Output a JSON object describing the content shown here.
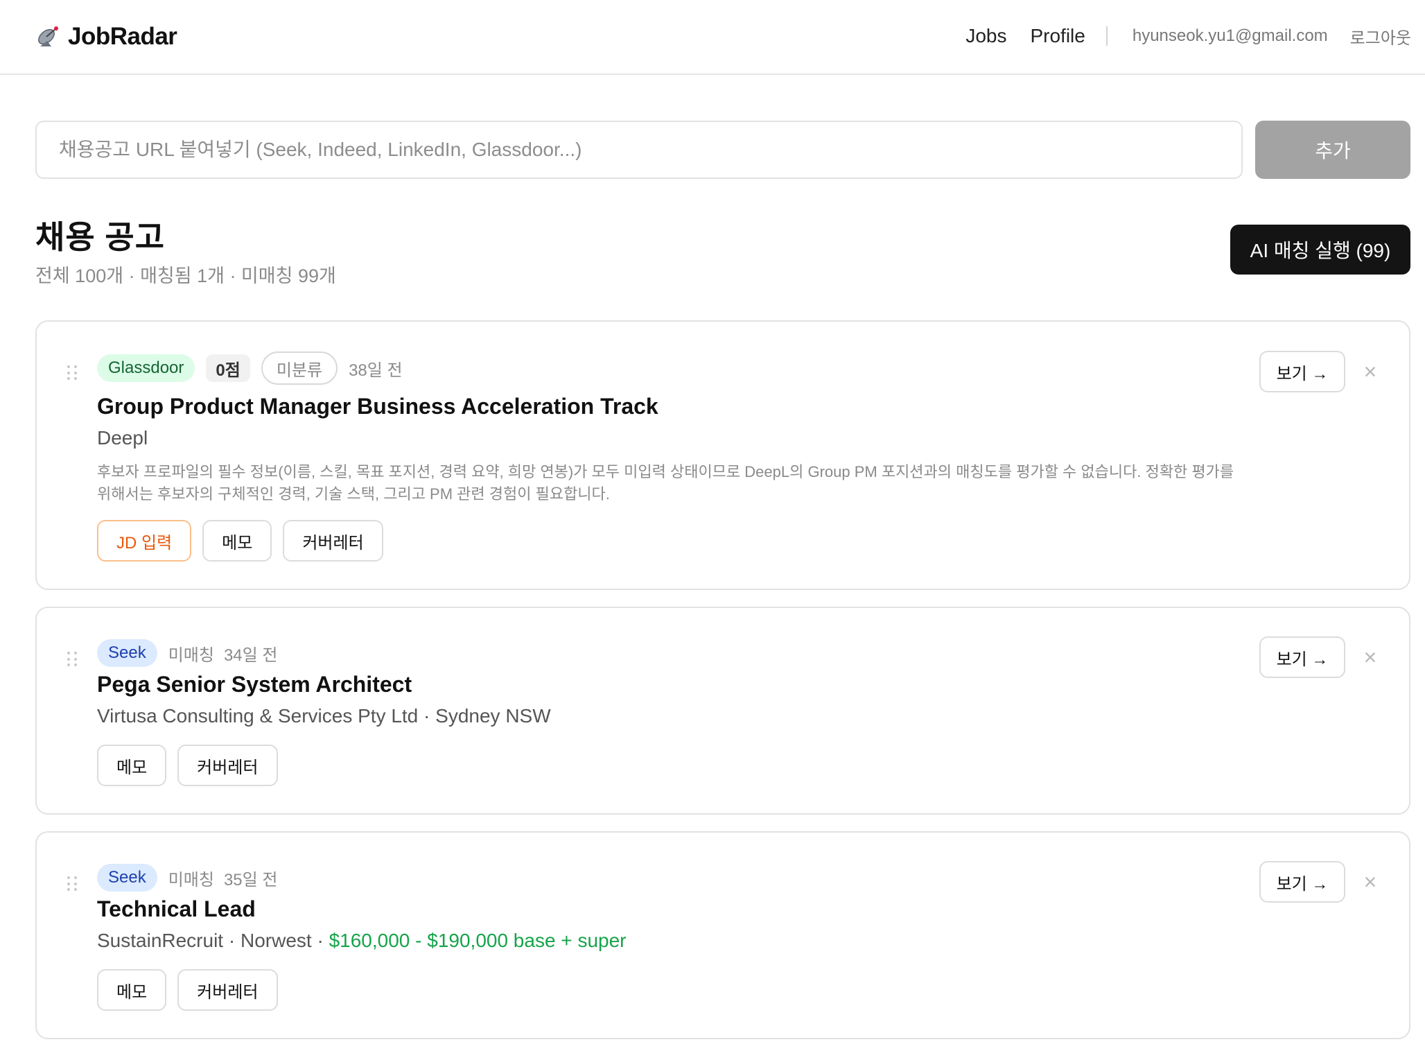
{
  "app": {
    "logo_icon": "satellite-dish-icon",
    "name": "JobRadar"
  },
  "nav": {
    "jobs": "Jobs",
    "profile": "Profile",
    "separator": "|",
    "email": "hyunseok.yu1@gmail.com",
    "logout": "로그아웃"
  },
  "url_form": {
    "placeholder": "채용공고 URL 붙여넣기 (Seek, Indeed, LinkedIn, Glassdoor...)",
    "value": "",
    "add_label": "추가"
  },
  "listing": {
    "title": "채용 공고",
    "stats": "전체 100개 · 매칭됨 1개 · 미매칭 99개",
    "ai_button": "AI 매칭 실행 (99)"
  },
  "colors": {
    "glassdoor_badge_bg": "#dcfce7",
    "seek_badge_bg": "#dbeafe",
    "salary": "#16a34a",
    "jd_button": "#ea580c",
    "ai_button_bg": "#141414"
  },
  "jobs": [
    {
      "source": "Glassdoor",
      "score": "0점",
      "category": "미분류",
      "age": "38일 전",
      "title": "Group Product Manager Business Acceleration Track",
      "company": "Deepl",
      "description": "후보자 프로파일의 필수 정보(이름, 스킬, 목표 포지션, 경력 요약, 희망 연봉)가 모두 미입력 상태이므로 DeepL의 Group PM 포지션과의 매칭도를 평가할 수 없습니다. 정확한 평가를 위해서는 후보자의 구체적인 경력, 기술 스택, 그리고 PM 관련 경험이 필요합니다.",
      "actions": {
        "jd": "JD 입력",
        "memo": "메모",
        "cover": "커버레터"
      },
      "view": "보기 →",
      "remove": "×"
    },
    {
      "source": "Seek",
      "status": "미매칭",
      "age": "34일 전",
      "title": "Pega Senior System Architect",
      "company": "Virtusa Consulting & Services Pty Ltd",
      "sep": " · ",
      "location": "Sydney NSW",
      "actions": {
        "memo": "메모",
        "cover": "커버레터"
      },
      "view": "보기 →",
      "remove": "×"
    },
    {
      "source": "Seek",
      "status": "미매칭",
      "age": "35일 전",
      "title": "Technical Lead",
      "company": "SustainRecruit",
      "sep": " · ",
      "location": "Norwest",
      "salary": "$160,000 - $190,000 base + super",
      "actions": {
        "memo": "메모",
        "cover": "커버레터"
      },
      "view": "보기 →",
      "remove": "×"
    }
  ]
}
